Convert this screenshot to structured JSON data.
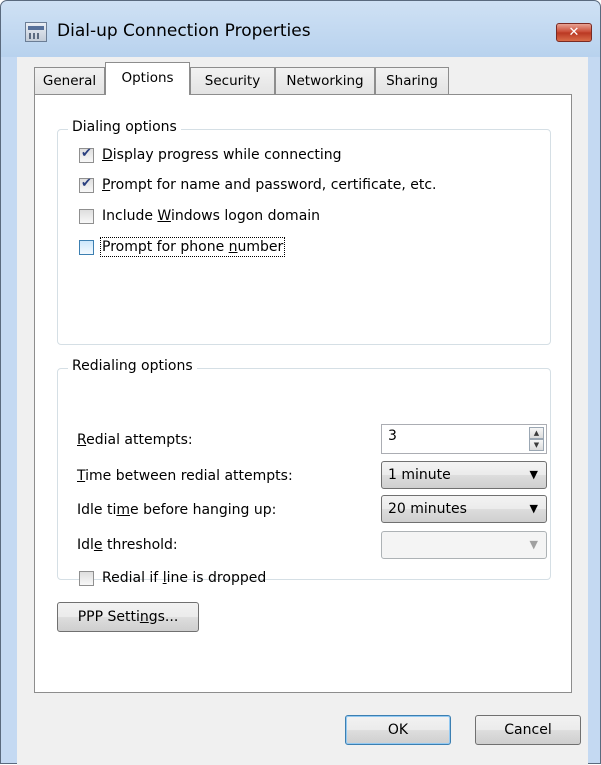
{
  "window": {
    "title": "Dial-up Connection Properties",
    "close_glyph": "✕"
  },
  "tabs": [
    {
      "label": "General"
    },
    {
      "label": "Options"
    },
    {
      "label": "Security"
    },
    {
      "label": "Networking"
    },
    {
      "label": "Sharing"
    }
  ],
  "active_tab": "Options",
  "dialing_options": {
    "legend": "Dialing options",
    "items": [
      {
        "pre": "",
        "u": "D",
        "post": "isplay progress while connecting",
        "checked": true
      },
      {
        "pre": "",
        "u": "P",
        "post": "rompt for name and password, certificate, etc.",
        "checked": true
      },
      {
        "pre": "Include ",
        "u": "W",
        "post": "indows logon domain",
        "checked": false
      },
      {
        "pre": "Prompt for phone ",
        "u": "n",
        "post": "umber",
        "checked": false
      }
    ]
  },
  "redialing_options": {
    "legend": "Redialing options",
    "redial_attempts": {
      "pre": "",
      "u": "R",
      "post": "edial attempts:",
      "value": "3"
    },
    "time_between": {
      "pre": "",
      "u": "T",
      "post": "ime between redial attempts:",
      "value": "1 minute"
    },
    "idle_time": {
      "pre": "Idle ti",
      "u": "m",
      "post": "e before hanging up:",
      "value": "20 minutes"
    },
    "idle_threshold": {
      "pre": "Idl",
      "u": "e",
      "post": " threshold:",
      "value": ""
    },
    "redial_if_dropped": {
      "pre": "Redial if ",
      "u": "l",
      "post": "ine is dropped",
      "checked": false
    }
  },
  "ppp_settings": {
    "pre": "PPP Setti",
    "u": "n",
    "post": "gs..."
  },
  "footer": {
    "ok_label": "OK",
    "cancel_label": "Cancel"
  },
  "colors": {
    "title_bar": "#cfe1f4",
    "close_button": "#c7452f",
    "default_button_border": "#3c7fb1",
    "group_border": "#d5dfe5"
  },
  "icons": {
    "window_icon": "dialup-connection-icon",
    "close": "close-icon",
    "spin_up": "spin-up-icon",
    "spin_down": "spin-down-icon",
    "dropdown": "chevron-down-icon"
  }
}
